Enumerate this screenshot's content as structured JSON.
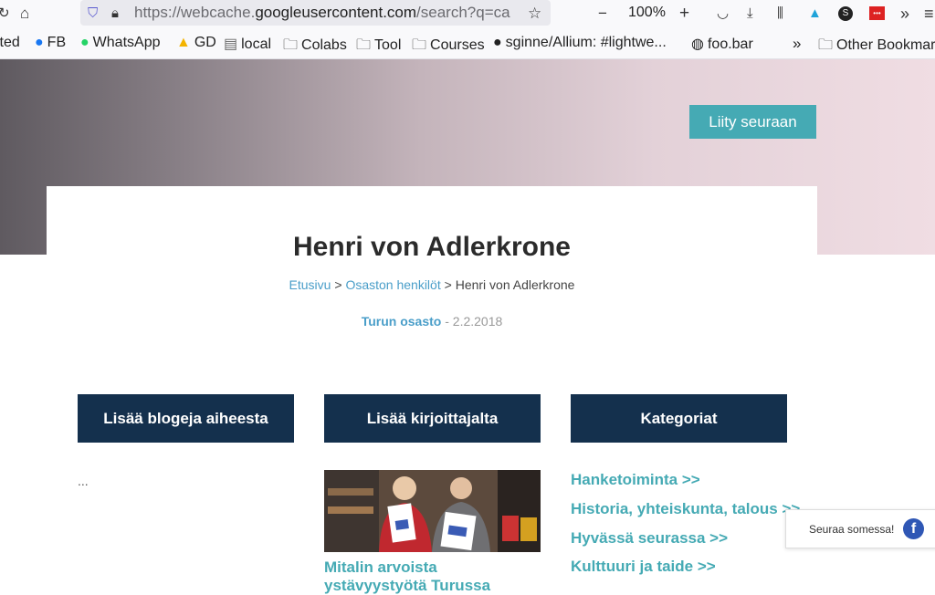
{
  "browser": {
    "url_prefix": "https://webcache.",
    "url_domain": "googleusercontent.com",
    "url_suffix": "/search?q=ca",
    "zoom": "100%",
    "bookmarks": [
      {
        "label": "ited",
        "icon": "none"
      },
      {
        "label": "FB",
        "icon": "facebook-icon"
      },
      {
        "label": "WhatsApp",
        "icon": "whatsapp-icon"
      },
      {
        "label": "GD",
        "icon": "google-drive-icon"
      },
      {
        "label": "local",
        "icon": "server-icon"
      },
      {
        "label": "Colabs",
        "icon": "folder-icon"
      },
      {
        "label": "Tool",
        "icon": "folder-icon"
      },
      {
        "label": "Courses",
        "icon": "folder-icon"
      },
      {
        "label": "sginne/Allium: #lightwe...",
        "icon": "github-icon"
      },
      {
        "label": "foo.bar",
        "icon": "globe-icon"
      },
      {
        "label": "Other Bookmar",
        "icon": "folder-icon"
      }
    ]
  },
  "header": {
    "join_button": "Liity seuraan"
  },
  "article": {
    "title": "Henri von Adlerkrone",
    "breadcrumb": {
      "home": "Etusivu",
      "sep1": " > ",
      "section": "Osaston henkilöt",
      "sep2": " > ",
      "current": "Henri von Adlerkrone"
    },
    "meta": {
      "department": "Turun osasto",
      "date": " - 2.2.2018"
    }
  },
  "columns": {
    "blogs_heading": "Lisää blogeja aiheesta",
    "blogs_placeholder": "...",
    "author_heading": "Lisää kirjoittajalta",
    "author_post_title": "Mitalin arvoista ystävyystyötä Turussa",
    "categories_heading": "Kategoriat",
    "categories": [
      "Hanketoiminta >>",
      "Historia, yhteiskunta, talous >>",
      "Hyvässä seurassa >>",
      "Kulttuuri ja taide >>"
    ]
  },
  "social": {
    "label": "Seuraa somessa!",
    "icon": "facebook-icon"
  },
  "colors": {
    "accent": "#45aab4",
    "navy": "#14304d",
    "link": "#4a9ec9"
  }
}
